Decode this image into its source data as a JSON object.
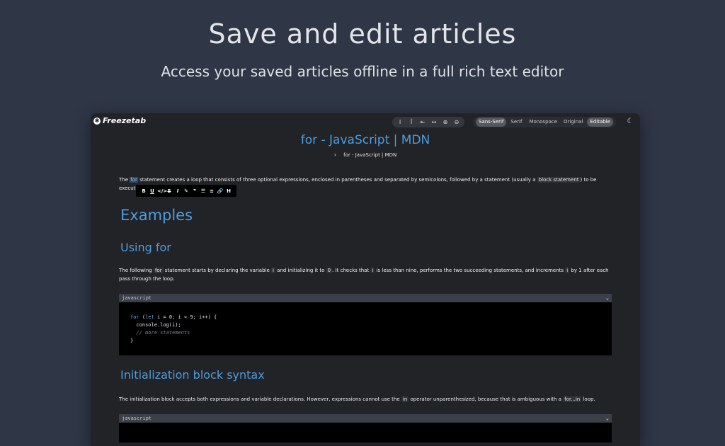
{
  "hero": {
    "title": "Save and edit articles",
    "subtitle": "Access your saved articles offline in a full rich text editor"
  },
  "app": {
    "name": "Freezetab",
    "toolbar": {
      "font_options": [
        "Sans-Serif",
        "Serif",
        "Monospace"
      ],
      "selected_font": "Sans-Serif",
      "mode_options": [
        "Original",
        "Editable"
      ],
      "selected_mode": "Editable"
    }
  },
  "article": {
    "title": "for - JavaScript | MDN",
    "breadcrumb": "for - JavaScript | MDN",
    "intro": {
      "p1": "The ",
      "hl": "for",
      "p2": " statement creates a loop that consists of three optional expressions, enclosed in parentheses and separated by semicolons, followed by a statement (usually a ",
      "code": "block statement",
      "p3": ") to be executed in the loop."
    },
    "h_examples": "Examples",
    "h_using_for": "Using for",
    "using_para": {
      "p1": "The following ",
      "c1": "for",
      "p2": " statement starts by declaring the variable ",
      "c2": "i",
      "p3": " and initializing it to ",
      "c3": "0",
      "p4": ". It checks that ",
      "c4": "i",
      "p5": " is less than nine, performs the two succeeding statements, and increments ",
      "c5": "i",
      "p6": " by 1 after each pass through the loop."
    },
    "code1": {
      "language": "javascript",
      "line1_kw1": "for",
      "line1_p1": " (",
      "line1_kw2": "let",
      "line1_p2": " i = 0; i < 9; i++) {",
      "line2": "  console.log(i);",
      "line3": "  // more statements",
      "line4": "}"
    },
    "h_init": "Initialization block syntax",
    "init_para": {
      "p1": "The initialization block accepts both expressions and variable declarations. However, expressions cannot use the ",
      "c1": "in",
      "p2": " operator unparenthesized, because that is ambiguous with a ",
      "c2": "for...in",
      "p3": " loop."
    },
    "code2": {
      "language": "javascript"
    }
  },
  "format_bar": {
    "bold": "B",
    "underline": "U",
    "code": "</>",
    "strike": "S",
    "italic": "I",
    "highlight": "✎",
    "quote": "❞",
    "ordered_list": "☰",
    "bullet_list": "≡",
    "link": "🔗",
    "heading": "H"
  },
  "toolbar_icons": [
    "text-cursor-icon",
    "text-height-icon",
    "width-narrow-icon",
    "width-wide-icon",
    "zoom-in-icon",
    "zoom-out-icon"
  ]
}
